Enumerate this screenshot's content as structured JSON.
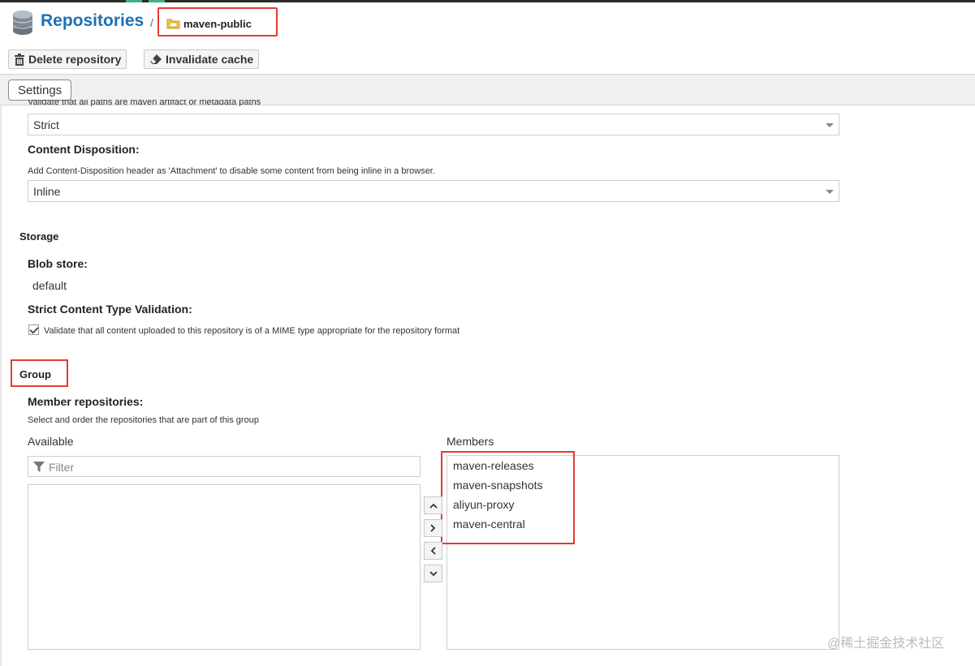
{
  "header": {
    "title": "Repositories",
    "separator": "/",
    "breadcrumb": "maven-public"
  },
  "toolbar": {
    "delete_label": "Delete repository",
    "invalidate_label": "Invalidate cache"
  },
  "tabs": {
    "settings_label": "Settings"
  },
  "form": {
    "clipped_help": "Validate that all paths are maven artifact or metadata paths",
    "layout_policy_value": "Strict",
    "content_disposition": {
      "label": "Content Disposition:",
      "help": "Add Content-Disposition header as 'Attachment' to disable some content from being inline in a browser.",
      "value": "Inline"
    },
    "storage": {
      "section": "Storage",
      "blob_label": "Blob store:",
      "blob_value": "default",
      "strict_label": "Strict Content Type Validation:",
      "strict_help": "Validate that all content uploaded to this repository is of a MIME type appropriate for the repository format",
      "strict_checked": true
    },
    "group": {
      "section": "Group",
      "member_label": "Member repositories:",
      "member_help": "Select and order the repositories that are part of this group",
      "available_label": "Available",
      "members_label": "Members",
      "filter_placeholder": "Filter",
      "members": [
        "maven-releases",
        "maven-snapshots",
        "aliyun-proxy",
        "maven-central"
      ]
    }
  },
  "watermark": "@稀土掘金技术社区",
  "colors": {
    "accent": "#1a70b8",
    "highlight": "#e53935"
  }
}
